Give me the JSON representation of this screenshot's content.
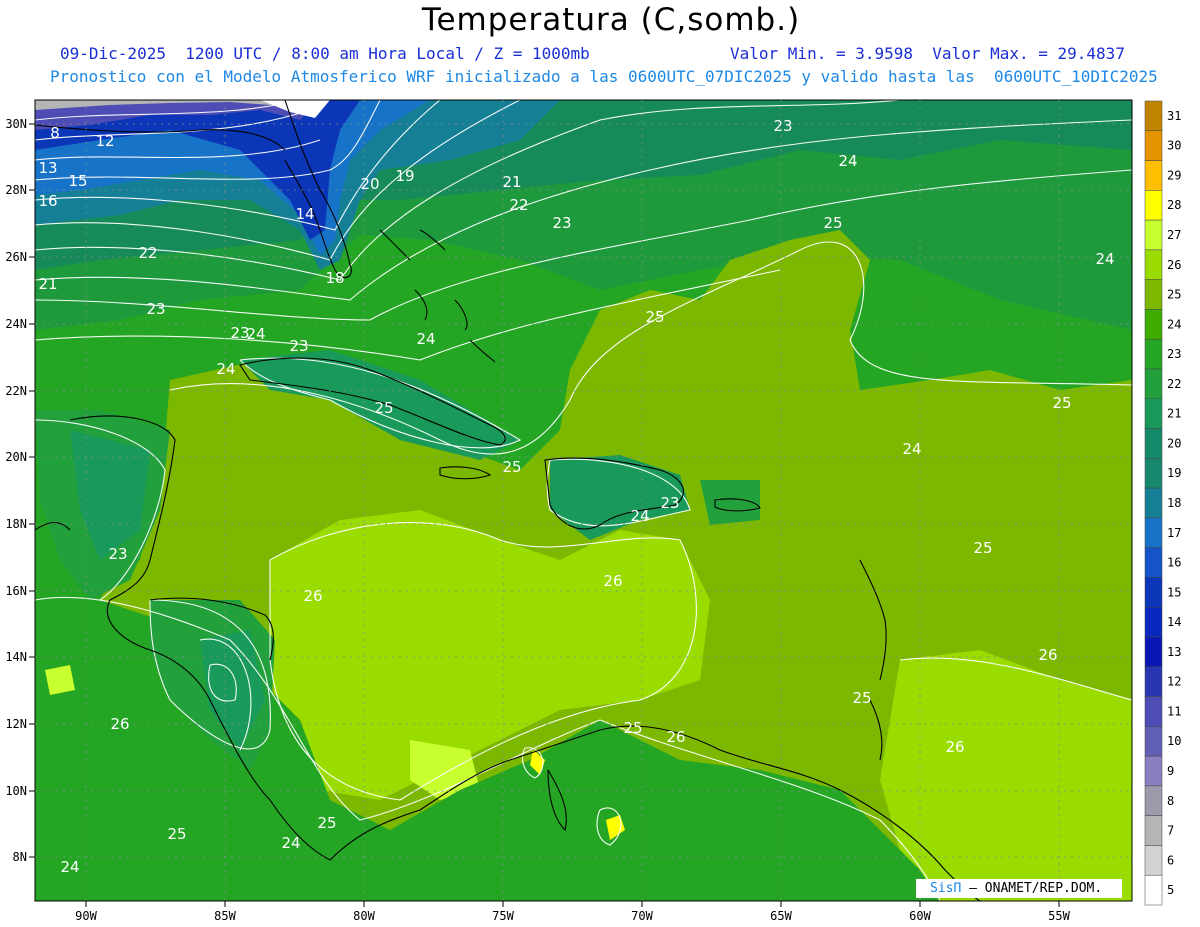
{
  "title": "Temperatura (C,somb.)",
  "subtitle": {
    "time": "09-Dic-2025  1200 UTC / 8:00 am Hora Local / Z = 1000mb",
    "range": "Valor Min. = 3.9598  Valor Max. = 29.4837",
    "model": "Pronostico con el Modelo Atmosferico WRF inicializado a las 0600UTC_07DIC2025 y valido hasta las  0600UTC_10DIC2025"
  },
  "credit": {
    "brand": "SisΠ",
    "org": "– ONAMET/REP.DOM."
  },
  "axes": {
    "lon_labels": [
      "90W",
      "85W",
      "80W",
      "75W",
      "70W",
      "65W",
      "60W",
      "55W"
    ],
    "lat_labels": [
      "30N",
      "28N",
      "26N",
      "24N",
      "22N",
      "20N",
      "18N",
      "16N",
      "14N",
      "12N",
      "10N",
      "8N"
    ]
  },
  "colorbar": {
    "labels": [
      "31",
      "30",
      "29",
      "28",
      "27",
      "26",
      "25",
      "24",
      "23",
      "22",
      "21",
      "20",
      "19",
      "18",
      "17",
      "16",
      "15",
      "14",
      "13",
      "12",
      "11",
      "10",
      "9",
      "8",
      "7",
      "6",
      "5"
    ],
    "colors": [
      "#c18400",
      "#e39400",
      "#ffbf00",
      "#ffff00",
      "#c8ff2e",
      "#9bdc00",
      "#7cb800",
      "#3ead00",
      "#24a624",
      "#22a03c",
      "#199a5a",
      "#148a6a",
      "#17876e",
      "#157f96",
      "#1773c8",
      "#1453c8",
      "#0b36b8",
      "#0828c0",
      "#0918b5",
      "#2a35b3",
      "#4d4db5",
      "#6060b5",
      "#8a80c0",
      "#9b9bab",
      "#b5b5b5",
      "#d2d2d2",
      "#ffffff"
    ]
  },
  "contour_labels": [
    {
      "v": "8"
    },
    {
      "v": "12"
    },
    {
      "v": "13"
    },
    {
      "v": "15"
    },
    {
      "v": "16"
    },
    {
      "v": "14"
    },
    {
      "v": "20"
    },
    {
      "v": "19"
    },
    {
      "v": "21"
    },
    {
      "v": "22"
    },
    {
      "v": "23"
    },
    {
      "v": "18"
    },
    {
      "v": "22"
    },
    {
      "v": "21"
    },
    {
      "v": "23"
    },
    {
      "v": "24"
    },
    {
      "v": "23"
    },
    {
      "v": "24"
    },
    {
      "v": "25"
    },
    {
      "v": "24"
    },
    {
      "v": "25"
    },
    {
      "v": "23"
    },
    {
      "v": "25"
    },
    {
      "v": "24"
    },
    {
      "v": "24"
    },
    {
      "v": "25"
    },
    {
      "v": "24"
    },
    {
      "v": "23"
    },
    {
      "v": "23"
    },
    {
      "v": "25"
    },
    {
      "v": "26"
    },
    {
      "v": "26"
    },
    {
      "v": "26"
    },
    {
      "v": "25"
    },
    {
      "v": "26"
    },
    {
      "v": "26"
    },
    {
      "v": "25"
    },
    {
      "v": "26"
    },
    {
      "v": "25"
    },
    {
      "v": "24"
    },
    {
      "v": "25"
    },
    {
      "v": "24"
    },
    {
      "v": "23"
    },
    {
      "v": "24"
    },
    {
      "v": "25"
    }
  ]
}
